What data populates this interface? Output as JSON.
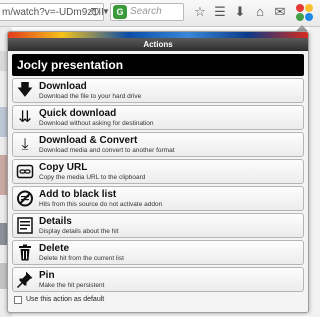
{
  "browser": {
    "url": "m/watch?v=-UDm9zTIP",
    "search_placeholder": "Search",
    "search_badge": "G"
  },
  "panel": {
    "header": "Actions",
    "title": "Jocly presentation",
    "actions": [
      {
        "label": "Download",
        "description": "Download the file to your hard drive",
        "icon": "download-arrow-icon"
      },
      {
        "label": "Quick download",
        "description": "Download without asking for destination",
        "icon": "quick-download-icon"
      },
      {
        "label": "Download & Convert",
        "description": "Download media and convert to another format",
        "icon": "download-convert-icon"
      },
      {
        "label": "Copy URL",
        "description": "Copy the media URL to the clipboard",
        "icon": "link-icon"
      },
      {
        "label": "Add to black list",
        "description": "Hits from this source do not activate addon",
        "icon": "blacklist-icon"
      },
      {
        "label": "Details",
        "description": "Display details about the hit",
        "icon": "details-icon"
      },
      {
        "label": "Delete",
        "description": "Delete hit from the current list",
        "icon": "trash-icon"
      },
      {
        "label": "Pin",
        "description": "Make the hit persistent",
        "icon": "pin-icon"
      }
    ],
    "default_label": "Use this action as default",
    "default_checked": false
  }
}
